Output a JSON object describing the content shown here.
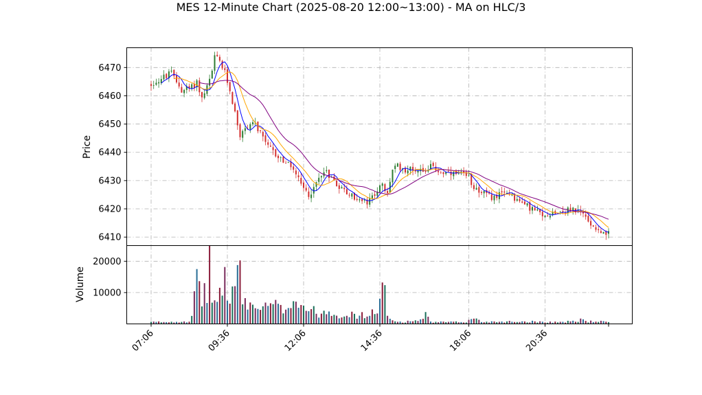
{
  "chart_data": {
    "type": "candlestick",
    "title": "MES 12-Minute Chart (2025-08-20 12:00~13:00) - MA on HLC/3",
    "price_panel": {
      "ylabel": "Price",
      "ylim": [
        6407,
        6477
      ],
      "yticks": [
        6410,
        6420,
        6430,
        6440,
        6450,
        6460,
        6470
      ],
      "grid": true
    },
    "volume_panel": {
      "ylabel": "Volume",
      "ylim": [
        0,
        25000
      ],
      "yticks": [
        10000,
        20000
      ],
      "grid": true
    },
    "x_axis": {
      "tick_labels": [
        "07:06",
        "09:36",
        "12:06",
        "14:36",
        "18:06",
        "20:36"
      ],
      "tick_bar_index": [
        0,
        30,
        60,
        90,
        125,
        155
      ]
    },
    "bar_count": 181,
    "up_color": "#2e7d32",
    "down_color": "#d32f2f",
    "volume_colors": [
      "#1a6e5a",
      "#7a2c5c",
      "#2a6f97",
      "#8b1d3a"
    ],
    "ma_colors": [
      "#0000ff",
      "#ffa500",
      "#800080"
    ],
    "price_path": [
      [
        0,
        6464
      ],
      [
        4,
        6466
      ],
      [
        8,
        6468
      ],
      [
        12,
        6462
      ],
      [
        16,
        6463
      ],
      [
        18,
        6465
      ],
      [
        20,
        6459
      ],
      [
        22,
        6463
      ],
      [
        24,
        6468
      ],
      [
        25,
        6474
      ],
      [
        27,
        6472
      ],
      [
        29,
        6468
      ],
      [
        31,
        6462
      ],
      [
        33,
        6454
      ],
      [
        35,
        6446
      ],
      [
        37,
        6448
      ],
      [
        40,
        6451
      ],
      [
        42,
        6448
      ],
      [
        45,
        6443
      ],
      [
        48,
        6440
      ],
      [
        52,
        6437
      ],
      [
        56,
        6434
      ],
      [
        58,
        6430
      ],
      [
        60,
        6427
      ],
      [
        62,
        6425
      ],
      [
        64,
        6427
      ],
      [
        66,
        6431
      ],
      [
        68,
        6434
      ],
      [
        70,
        6432
      ],
      [
        74,
        6428
      ],
      [
        78,
        6425
      ],
      [
        82,
        6423
      ],
      [
        85,
        6422
      ],
      [
        87,
        6424
      ],
      [
        89,
        6427
      ],
      [
        91,
        6428
      ],
      [
        93,
        6425
      ],
      [
        94,
        6430
      ],
      [
        95,
        6434
      ],
      [
        97,
        6435
      ],
      [
        100,
        6434
      ],
      [
        104,
        6434
      ],
      [
        108,
        6434
      ],
      [
        110,
        6435
      ],
      [
        114,
        6433
      ],
      [
        118,
        6432
      ],
      [
        122,
        6432
      ],
      [
        125,
        6431
      ],
      [
        127,
        6428
      ],
      [
        130,
        6426
      ],
      [
        134,
        6424
      ],
      [
        138,
        6425
      ],
      [
        141,
        6426
      ],
      [
        144,
        6423
      ],
      [
        148,
        6421
      ],
      [
        152,
        6419
      ],
      [
        154,
        6417
      ],
      [
        156,
        6418
      ],
      [
        158,
        6419
      ],
      [
        162,
        6419
      ],
      [
        166,
        6420
      ],
      [
        168,
        6419
      ],
      [
        170,
        6418
      ],
      [
        172,
        6416
      ],
      [
        174,
        6414
      ],
      [
        176,
        6413
      ],
      [
        178,
        6411
      ],
      [
        180,
        6411
      ]
    ],
    "volume_profile": [
      [
        0,
        600
      ],
      [
        8,
        700
      ],
      [
        15,
        900
      ],
      [
        16,
        2000
      ],
      [
        17,
        12000
      ],
      [
        18,
        13000
      ],
      [
        20,
        9000
      ],
      [
        22,
        12000
      ],
      [
        23,
        20500
      ],
      [
        24,
        9000
      ],
      [
        26,
        7000
      ],
      [
        28,
        14000
      ],
      [
        29,
        15000
      ],
      [
        31,
        7500
      ],
      [
        33,
        13000
      ],
      [
        34,
        22500
      ],
      [
        36,
        8000
      ],
      [
        40,
        6000
      ],
      [
        44,
        5000
      ],
      [
        48,
        6500
      ],
      [
        52,
        4500
      ],
      [
        56,
        9000
      ],
      [
        58,
        7000
      ],
      [
        62,
        5000
      ],
      [
        66,
        3500
      ],
      [
        70,
        4500
      ],
      [
        74,
        3000
      ],
      [
        78,
        3500
      ],
      [
        80,
        2500
      ],
      [
        83,
        3000
      ],
      [
        85,
        2500
      ],
      [
        88,
        4000
      ],
      [
        90,
        7000
      ],
      [
        91,
        15500
      ],
      [
        92,
        11000
      ],
      [
        93,
        2000
      ],
      [
        96,
        800
      ],
      [
        100,
        700
      ],
      [
        107,
        1500
      ],
      [
        108,
        3000
      ],
      [
        110,
        600
      ],
      [
        120,
        600
      ],
      [
        124,
        700
      ],
      [
        126,
        1500
      ],
      [
        127,
        2000
      ],
      [
        130,
        700
      ],
      [
        140,
        800
      ],
      [
        150,
        800
      ],
      [
        155,
        700
      ],
      [
        160,
        600
      ],
      [
        168,
        900
      ],
      [
        169,
        1600
      ],
      [
        172,
        800
      ],
      [
        176,
        900
      ],
      [
        180,
        500
      ]
    ]
  }
}
